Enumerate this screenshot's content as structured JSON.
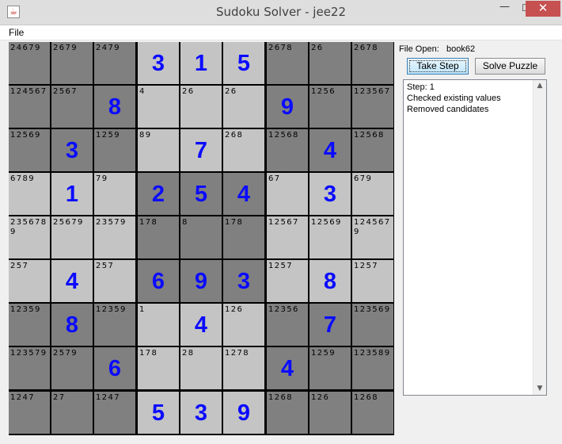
{
  "window": {
    "title": "Sudoku Solver - jee22",
    "app_icon_glyph": "☕",
    "minimize_glyph": "—",
    "maximize_glyph": "☐",
    "close_glyph": "✕"
  },
  "menu": {
    "file_label": "File"
  },
  "panel": {
    "file_open_label": "File Open:",
    "file_name": "book62",
    "take_step_label": "Take Step",
    "solve_label": "Solve Puzzle",
    "log_text": "Step: 1\nChecked existing values\nRemoved candidates",
    "scroll_up_glyph": "▲",
    "scroll_down_glyph": "▼"
  },
  "colors": {
    "value_blue": "#0b0bff",
    "dark_cell": "#808080",
    "light_cell": "#c4c4c4"
  },
  "board": {
    "rows": [
      [
        {
          "c": "24679"
        },
        {
          "c": "2679"
        },
        {
          "c": "2479"
        },
        {
          "v": "3"
        },
        {
          "v": "1"
        },
        {
          "v": "5"
        },
        {
          "c": "2678"
        },
        {
          "c": "26"
        },
        {
          "c": "2678"
        }
      ],
      [
        {
          "c": "124567"
        },
        {
          "c": "2567"
        },
        {
          "v": "8"
        },
        {
          "c": "4"
        },
        {
          "c": "26"
        },
        {
          "c": "26"
        },
        {
          "v": "9"
        },
        {
          "c": "1256"
        },
        {
          "c": "123567"
        }
      ],
      [
        {
          "c": "12569"
        },
        {
          "v": "3"
        },
        {
          "c": "1259"
        },
        {
          "c": "89"
        },
        {
          "v": "7"
        },
        {
          "c": "268"
        },
        {
          "c": "12568"
        },
        {
          "v": "4"
        },
        {
          "c": "12568"
        }
      ],
      [
        {
          "c": "6789"
        },
        {
          "v": "1"
        },
        {
          "c": "79"
        },
        {
          "v": "2"
        },
        {
          "v": "5"
        },
        {
          "v": "4"
        },
        {
          "c": "67"
        },
        {
          "v": "3"
        },
        {
          "c": "679"
        }
      ],
      [
        {
          "c": "2356789"
        },
        {
          "c": "25679"
        },
        {
          "c": "23579"
        },
        {
          "c": "178"
        },
        {
          "c": "8"
        },
        {
          "c": "178"
        },
        {
          "c": "12567"
        },
        {
          "c": "12569"
        },
        {
          "c": "1245679"
        }
      ],
      [
        {
          "c": "257"
        },
        {
          "v": "4"
        },
        {
          "c": "257"
        },
        {
          "v": "6"
        },
        {
          "v": "9"
        },
        {
          "v": "3"
        },
        {
          "c": "1257"
        },
        {
          "v": "8"
        },
        {
          "c": "1257"
        }
      ],
      [
        {
          "c": "12359"
        },
        {
          "v": "8"
        },
        {
          "c": "12359"
        },
        {
          "c": "1"
        },
        {
          "v": "4"
        },
        {
          "c": "126"
        },
        {
          "c": "12356"
        },
        {
          "v": "7"
        },
        {
          "c": "123569"
        }
      ],
      [
        {
          "c": "123579"
        },
        {
          "c": "2579"
        },
        {
          "v": "6"
        },
        {
          "c": "178"
        },
        {
          "c": "28"
        },
        {
          "c": "1278"
        },
        {
          "v": "4"
        },
        {
          "c": "1259"
        },
        {
          "c": "123589"
        }
      ],
      [
        {
          "c": "1247"
        },
        {
          "c": "27"
        },
        {
          "c": "1247"
        },
        {
          "v": "5"
        },
        {
          "v": "3"
        },
        {
          "v": "9"
        },
        {
          "c": "1268"
        },
        {
          "c": "126"
        },
        {
          "c": "1268"
        }
      ]
    ]
  }
}
